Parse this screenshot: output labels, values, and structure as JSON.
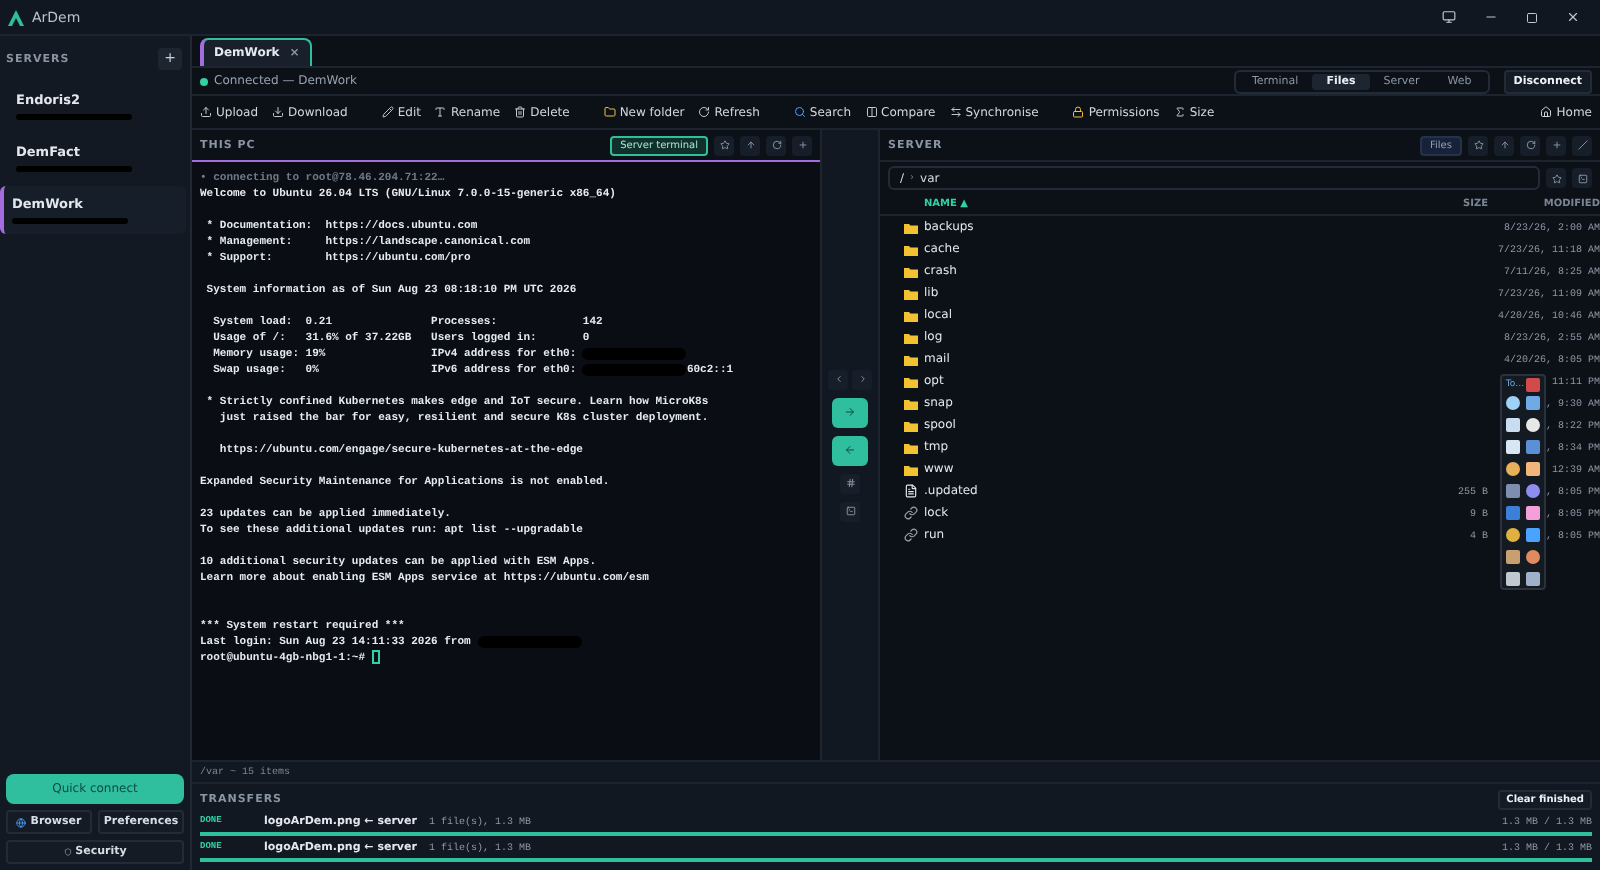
{
  "window": {
    "title": "ArDem"
  },
  "sidebar": {
    "header": "SERVERS",
    "add": "+",
    "servers": [
      {
        "name": "Endoris2",
        "selected": false
      },
      {
        "name": "DemFact",
        "selected": false
      },
      {
        "name": "DemWork",
        "selected": true
      }
    ],
    "quick_connect": "Quick connect",
    "browser": "Browser",
    "preferences": "Preferences",
    "security": "Security"
  },
  "session_tabs": [
    {
      "label": "DemWork",
      "close": "×",
      "selected": true
    }
  ],
  "connection": {
    "status": "Connected — DemWork",
    "connected": true
  },
  "view_tabs": [
    {
      "label": "Terminal",
      "selected": false
    },
    {
      "label": "Files",
      "selected": true
    },
    {
      "label": "Server",
      "selected": false
    },
    {
      "label": "Web",
      "selected": false
    }
  ],
  "disconnect": "Disconnect",
  "toolbar_groups": [
    [
      {
        "kind": "upload",
        "label": "Upload"
      },
      {
        "kind": "download",
        "label": "Download"
      }
    ],
    [
      {
        "kind": "edit",
        "label": "Edit"
      },
      {
        "kind": "rename",
        "label": "Rename"
      },
      {
        "kind": "delete",
        "label": "Delete"
      }
    ],
    [
      {
        "kind": "folder",
        "label": "New folder"
      },
      {
        "kind": "refresh",
        "label": "Refresh"
      }
    ],
    [
      {
        "kind": "search",
        "label": "Search"
      },
      {
        "kind": "compare",
        "label": "Compare"
      },
      {
        "kind": "sync",
        "label": "Synchronise"
      }
    ],
    [
      {
        "kind": "lock",
        "label": "Permissions"
      },
      {
        "kind": "size",
        "label": "Size"
      }
    ]
  ],
  "home": "Home",
  "local_pane": {
    "title": "THIS PC",
    "server_terminal": "Server terminal",
    "lines": [
      {
        "kind": "dim",
        "text": "• connecting to root@78.46.204.71:22…"
      },
      {
        "kind": "normal",
        "text": "Welcome to Ubuntu 26.04 LTS (GNU/Linux 7.0.0-15-generic x86_64)"
      },
      {
        "kind": "blank"
      },
      {
        "kind": "normal",
        "text": " * Documentation:  https://docs.ubuntu.com"
      },
      {
        "kind": "normal",
        "text": " * Management:     https://landscape.canonical.com"
      },
      {
        "kind": "normal",
        "text": " * Support:        https://ubuntu.com/pro"
      },
      {
        "kind": "blank"
      },
      {
        "kind": "normal",
        "text": " System information as of Sun Aug 23 08:18:10 PM UTC 2026"
      },
      {
        "kind": "blank"
      },
      {
        "kind": "normal",
        "text": "  System load:  0.21               Processes:             142"
      },
      {
        "kind": "normal",
        "text": "  Usage of /:   31.6% of 37.22GB   Users logged in:       0"
      },
      {
        "kind": "normal",
        "text": "  Memory usage: 19%                IPv4 address for eth0: ",
        "redacted": true
      },
      {
        "kind": "normal",
        "text": "  Swap usage:   0%                 IPv6 address for eth0: ",
        "redacted": true,
        "suffix": "60c2::1"
      },
      {
        "kind": "blank"
      },
      {
        "kind": "normal",
        "text": " * Strictly confined Kubernetes makes edge and IoT secure. Learn how MicroK8s"
      },
      {
        "kind": "normal",
        "text": "   just raised the bar for easy, resilient and secure K8s cluster deployment."
      },
      {
        "kind": "blank"
      },
      {
        "kind": "normal",
        "text": "   https://ubuntu.com/engage/secure-kubernetes-at-the-edge"
      },
      {
        "kind": "blank"
      },
      {
        "kind": "normal",
        "text": "Expanded Security Maintenance for Applications is not enabled."
      },
      {
        "kind": "blank"
      },
      {
        "kind": "normal",
        "text": "23 updates can be applied immediately."
      },
      {
        "kind": "normal",
        "text": "To see these additional updates run: apt list --upgradable"
      },
      {
        "kind": "blank"
      },
      {
        "kind": "normal",
        "text": "10 additional security updates can be applied with ESM Apps."
      },
      {
        "kind": "normal",
        "text": "Learn more about enabling ESM Apps service at https://ubuntu.com/esm"
      },
      {
        "kind": "blank"
      },
      {
        "kind": "blank"
      },
      {
        "kind": "normal",
        "text": "*** System restart required ***"
      },
      {
        "kind": "normal",
        "text": "Last login: Sun Aug 23 14:11:33 2026 from ",
        "redacted": true
      },
      {
        "kind": "prompt",
        "text": "root@ubuntu-4gb-nbg1-1:~# "
      }
    ]
  },
  "remote_pane": {
    "title": "SERVER",
    "files_button": "Files",
    "path_root": "/",
    "path_sep": "›",
    "path_dir": "var",
    "columns": [
      {
        "label": "NAME ▲",
        "sorted": true
      },
      {
        "label": "SIZE",
        "sorted": false
      },
      {
        "label": "MODIFIED",
        "sorted": false
      }
    ],
    "rows": [
      {
        "kind": "folder",
        "name": "backups",
        "modified": "8/23/26, 2:00 AM"
      },
      {
        "kind": "folder",
        "name": "cache",
        "modified": "7/23/26, 11:18 AM"
      },
      {
        "kind": "folder",
        "name": "crash",
        "modified": "7/11/26, 8:25 AM"
      },
      {
        "kind": "folder",
        "name": "lib",
        "modified": "7/23/26, 11:09 AM"
      },
      {
        "kind": "folder",
        "name": "local",
        "modified": "4/20/26, 10:46 AM"
      },
      {
        "kind": "folder",
        "name": "log",
        "modified": "8/23/26, 2:55 AM"
      },
      {
        "kind": "folder",
        "name": "mail",
        "modified": "4/20/26, 8:05 PM"
      },
      {
        "kind": "folder",
        "name": "opt",
        "modified": "11:11 PM"
      },
      {
        "kind": "folder",
        "name": "snap",
        "modified": ", 9:30 AM"
      },
      {
        "kind": "folder",
        "name": "spool",
        "modified": ", 8:22 PM"
      },
      {
        "kind": "folder",
        "name": "tmp",
        "modified": ", 8:34 PM"
      },
      {
        "kind": "folder",
        "name": "www",
        "modified": "12:39 AM"
      },
      {
        "kind": "file",
        "name": ".updated",
        "size": "255 B",
        "modified": ", 8:05 PM"
      },
      {
        "kind": "link",
        "name": "lock",
        "size": "9 B",
        "modified": ", 8:05 PM"
      },
      {
        "kind": "link",
        "name": "run",
        "size": "4 B",
        "modified": ", 8:05 PM"
      }
    ],
    "footer": "/var ~ 15 items"
  },
  "tool_palette": {
    "title": "To…"
  },
  "transfers": {
    "title": "TRANSFERS",
    "clear": "Clear finished",
    "items": [
      {
        "status": "DONE",
        "name": "logoArDem.png ← server",
        "detail": "1 file(s), 1.3 MB",
        "progress": "1.3 MB / 1.3 MB",
        "level": 1
      },
      {
        "status": "DONE",
        "name": "logoArDem.png ← server",
        "detail": "1 file(s), 1.3 MB",
        "progress": "1.3 MB / 1.3 MB",
        "level": 1
      }
    ]
  }
}
